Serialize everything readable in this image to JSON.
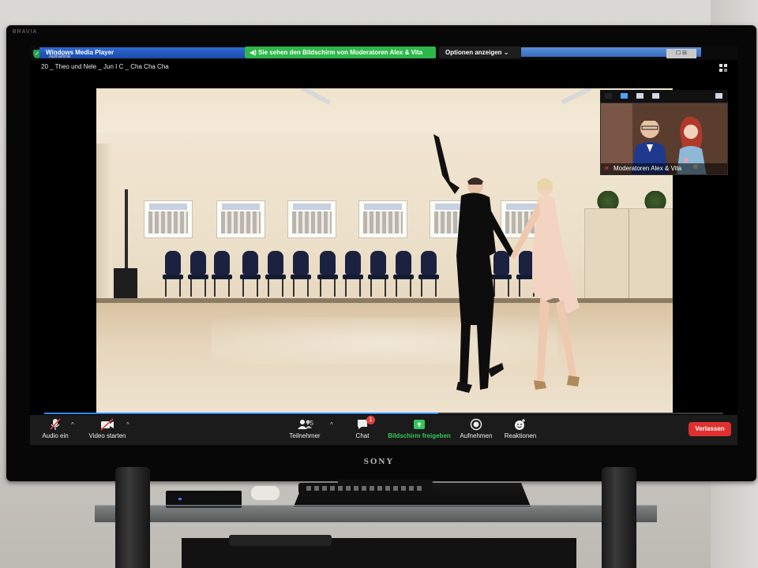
{
  "tv": {
    "brand_corner": "BRAVIA",
    "brand_bottom": "SONY"
  },
  "window": {
    "app_title": "Windows Media Player",
    "recording_label": "Aufnahme",
    "window_controls": "☐ ⊟"
  },
  "banner": {
    "sharing_text": "Sie sehen den Bildschirm von Moderatoren Alex & Vita",
    "options_label": "Optionen anzeigen"
  },
  "video": {
    "title": "20 _ Theo und Nele _ Jun I C _ Cha Cha Cha",
    "progress_fraction": 0.58
  },
  "participant": {
    "name": "Moderatoren Alex & Vita"
  },
  "toolbar": {
    "audio_label": "Audio ein",
    "video_label": "Video starten",
    "participants_label": "Teilnehmer",
    "participants_count": "75",
    "chat_label": "Chat",
    "chat_badge": "1",
    "share_label": "Bildschirm freigeben",
    "record_label": "Aufnehmen",
    "reactions_label": "Reaktionen",
    "leave_label": "Verlassen"
  },
  "colors": {
    "share_green": "#34c759",
    "leave_red": "#e02f2f",
    "banner_green": "#2eb84b",
    "progress_blue": "#2d8cff"
  },
  "icons": [
    "mic-off-icon",
    "video-off-icon",
    "participants-icon",
    "chat-icon",
    "share-screen-icon",
    "record-icon",
    "reactions-icon",
    "shield-icon",
    "layout-icon",
    "chevron-down-icon"
  ]
}
